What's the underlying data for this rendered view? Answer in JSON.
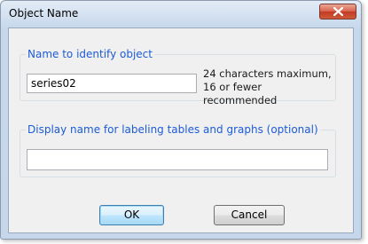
{
  "window": {
    "title": "Object Name",
    "close_icon": "close-x-icon"
  },
  "name_group": {
    "legend": "Name to identify object",
    "value": "series02",
    "hint": "24 characters maximum, 16 or fewer recommended"
  },
  "display_group": {
    "legend": "Display name for labeling tables and graphs  (optional)",
    "value": ""
  },
  "buttons": {
    "ok": "OK",
    "cancel": "Cancel"
  },
  "colors": {
    "legend_text": "#1c5bd8",
    "close_button": "#c23a22"
  }
}
